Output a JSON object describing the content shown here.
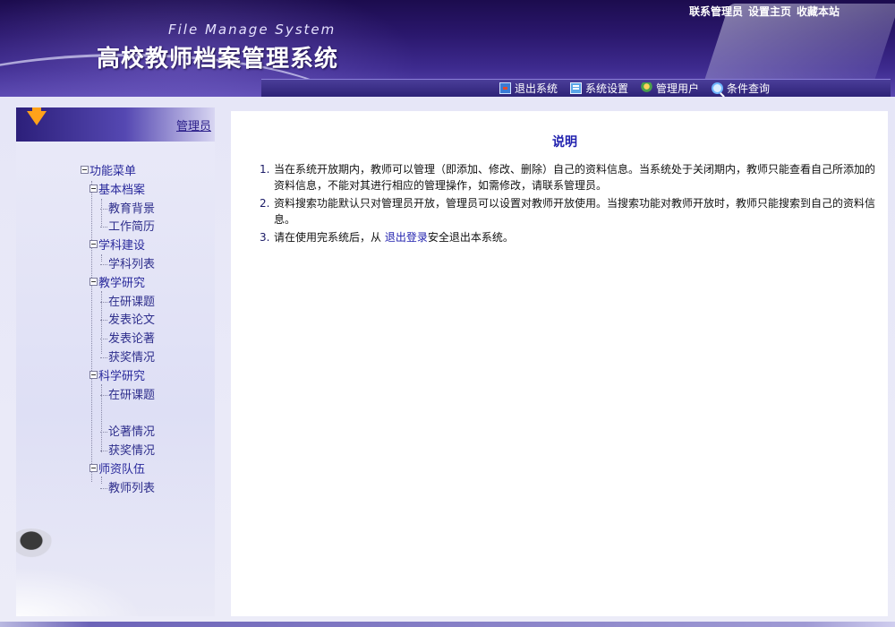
{
  "header": {
    "subtitle_en": "File Manage System",
    "title_cn": "高校教师档案管理系统",
    "top_links": [
      "联系管理员",
      "设置主页",
      "收藏本站"
    ],
    "toolbar": {
      "logout": "退出系统",
      "settings": "系统设置",
      "manage_users": "管理用户",
      "search": "条件查询"
    }
  },
  "sidebar": {
    "role_link": "管理员",
    "menu": {
      "root": "功能菜单",
      "groups": [
        {
          "label": "基本档案",
          "items": [
            "教育背景",
            "工作简历"
          ]
        },
        {
          "label": "学科建设",
          "items": [
            "学科列表"
          ]
        },
        {
          "label": "教学研究",
          "items": [
            "在研课题",
            "发表论文",
            "发表论著",
            "获奖情况"
          ]
        },
        {
          "label": "科学研究",
          "items": [
            "在研课题",
            "",
            "论著情况",
            "获奖情况"
          ]
        },
        {
          "label": "师资队伍",
          "items": [
            "教师列表"
          ]
        }
      ]
    }
  },
  "main": {
    "title": "说明",
    "notes": [
      {
        "num": "1.",
        "text": "当在系统开放期内，教师可以管理（即添加、修改、删除）自己的资料信息。当系统处于关闭期内，教师只能查看自己所添加的资料信息，不能对其进行相应的管理操作，如需修改，请联系管理员。"
      },
      {
        "num": "2.",
        "text": "资料搜索功能默认只对管理员开放，管理员可以设置对教师开放使用。当搜索功能对教师开放时，教师只能搜索到自己的资料信息。"
      },
      {
        "num": "3.",
        "prefix": "请在使用完系统后，从 ",
        "link": "退出登录",
        "suffix": "安全退出本系统。"
      }
    ]
  }
}
